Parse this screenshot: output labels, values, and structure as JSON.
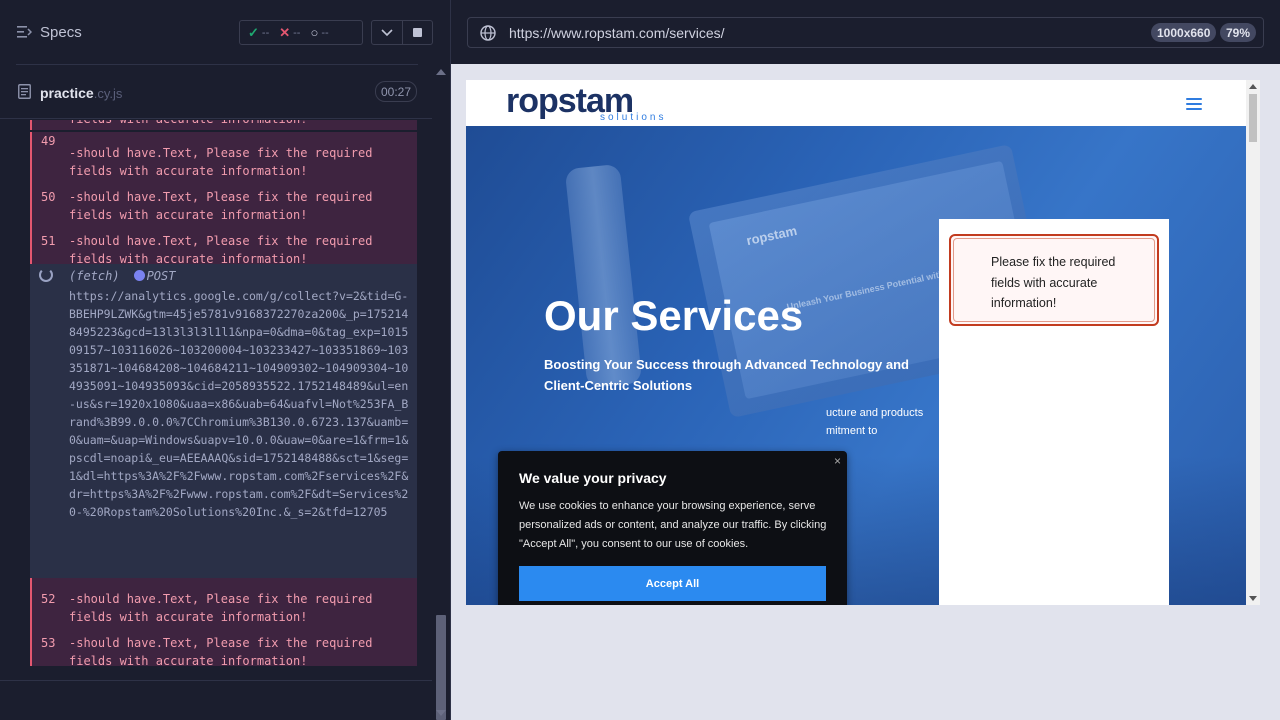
{
  "sidebar": {
    "specs_label": "Specs",
    "stats": {
      "passed": "--",
      "failed": "--",
      "pending": "--"
    },
    "file": {
      "name": "practice",
      "ext": ".cy.js",
      "duration": "00:27"
    }
  },
  "log": {
    "cut_text": "fields with accurate information!",
    "commands": [
      {
        "num": "49",
        "text": "-should  have.Text, Please fix the required fields with accurate information!"
      },
      {
        "num": "50",
        "text": "-should  have.Text, Please fix the required fields with accurate information!"
      },
      {
        "num": "51",
        "text": "-should  have.Text, Please fix the required fields with accurate information!"
      },
      {
        "num": "52",
        "text": "-should  have.Text, Please fix the required fields with accurate information!"
      },
      {
        "num": "53",
        "text": "-should  have.Text, Please fix the required fields with accurate information!"
      }
    ],
    "fetch": {
      "label": "(fetch)",
      "method": "POST",
      "url": "https://analytics.google.com/g/collect?v=2&tid=G-BBEHP9LZWK&gtm=45je5781v9168372270za200&_p=1752148495223&gcd=13l3l3l3l1l1&npa=0&dma=0&tag_exp=101509157~103116026~103200004~103233427~103351869~103351871~104684208~104684211~104909302~104909304~104935091~104935093&cid=2058935522.1752148489&ul=en-us&sr=1920x1080&uaa=x86&uab=64&uafvl=Not%253FA_Brand%3B99.0.0.0%7CChromium%3B130.0.6723.137&uamb=0&uam=&uap=Windows&uapv=10.0.0&uaw=0&are=1&frm=1&pscdl=noapi&_eu=AEEAAAQ&sid=1752148488&sct=1&seg=1&dl=https%3A%2F%2Fwww.ropstam.com%2Fservices%2F&dr=https%3A%2F%2Fwww.ropstam.com%2F&dt=Services%20-%20Ropstam%20Solutions%20Inc.&_s=2&tfd=12705"
    }
  },
  "browser": {
    "url": "https://www.ropstam.com/services/",
    "viewport": "1000x660",
    "zoom": "79%"
  },
  "site": {
    "logo": "ropstam",
    "logo_sub": "solutions",
    "hero_title": "Our Services",
    "hero_subtitle": "Boosting Your Success through Advanced Technology and Client-Centric Solutions",
    "hero_body": "ucture and products mitment to",
    "bg_brand": "ropstam",
    "bg_tagline": "Unleash Your Business Potential with Our Trusted Outsourcing",
    "alert_text": "Please fix the required fields with accurate information!",
    "cookie": {
      "close": "×",
      "title": "We value your privacy",
      "body": "We use cookies to enhance your browsing experience, serve personalized ads or content, and analyze our traffic. By clicking \"Accept All\", you consent to our use of cookies.",
      "accept": "Accept All"
    }
  },
  "colors": {
    "fail_bg": "#3e2440",
    "fail_border": "#e45770",
    "fail_text": "#f29cae",
    "accent_blue": "#2b8af0",
    "alert_border": "#c23b1f"
  }
}
